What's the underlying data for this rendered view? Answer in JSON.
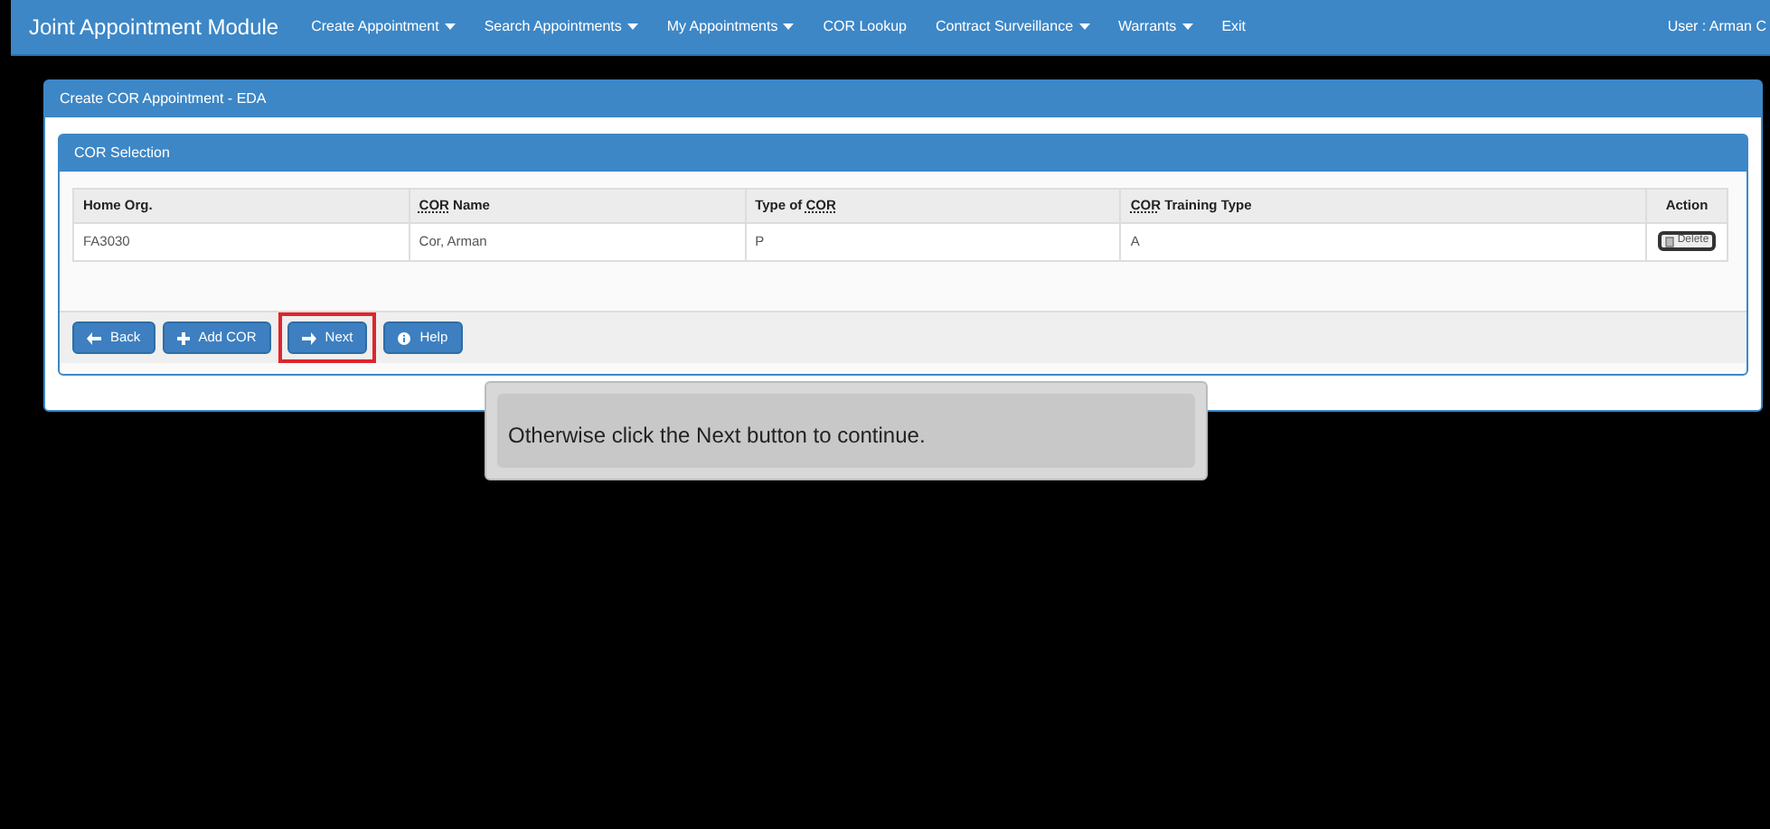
{
  "navbar": {
    "brand": "Joint Appointment Module",
    "menu": [
      {
        "label": "Create Appointment",
        "dropdown": true
      },
      {
        "label": "Search Appointments",
        "dropdown": true
      },
      {
        "label": "My Appointments",
        "dropdown": true
      },
      {
        "label": "COR Lookup",
        "dropdown": false
      },
      {
        "label": "Contract Surveillance",
        "dropdown": true
      },
      {
        "label": "Warrants",
        "dropdown": true
      },
      {
        "label": "Exit",
        "dropdown": false
      }
    ],
    "user": "User : Arman C"
  },
  "page_panel": {
    "title": "Create COR Appointment - EDA"
  },
  "selection_panel": {
    "title": "COR Selection",
    "table": {
      "columns": [
        {
          "parts": [
            {
              "text": "Home Org.",
              "abbr": false
            }
          ]
        },
        {
          "parts": [
            {
              "text": "COR",
              "abbr": true
            },
            {
              "text": " Name",
              "abbr": false
            }
          ]
        },
        {
          "parts": [
            {
              "text": "Type of ",
              "abbr": false
            },
            {
              "text": "COR",
              "abbr": true
            }
          ]
        },
        {
          "parts": [
            {
              "text": "COR",
              "abbr": true
            },
            {
              "text": " Training Type",
              "abbr": false
            }
          ]
        },
        {
          "parts": [
            {
              "text": "Action",
              "abbr": false
            }
          ]
        }
      ],
      "rows": [
        {
          "cells": [
            "FA3030",
            "Cor, Arman",
            "P",
            "A"
          ],
          "action": "Delete"
        }
      ]
    },
    "buttons": [
      {
        "label": "Back",
        "kind": "back",
        "highlighted": false
      },
      {
        "label": "Add COR",
        "kind": "add",
        "highlighted": false
      },
      {
        "label": "Next",
        "kind": "next",
        "highlighted": true
      },
      {
        "label": "Help",
        "kind": "help",
        "highlighted": false
      }
    ]
  },
  "tooltip": {
    "text": "Otherwise click the Next button to continue."
  }
}
